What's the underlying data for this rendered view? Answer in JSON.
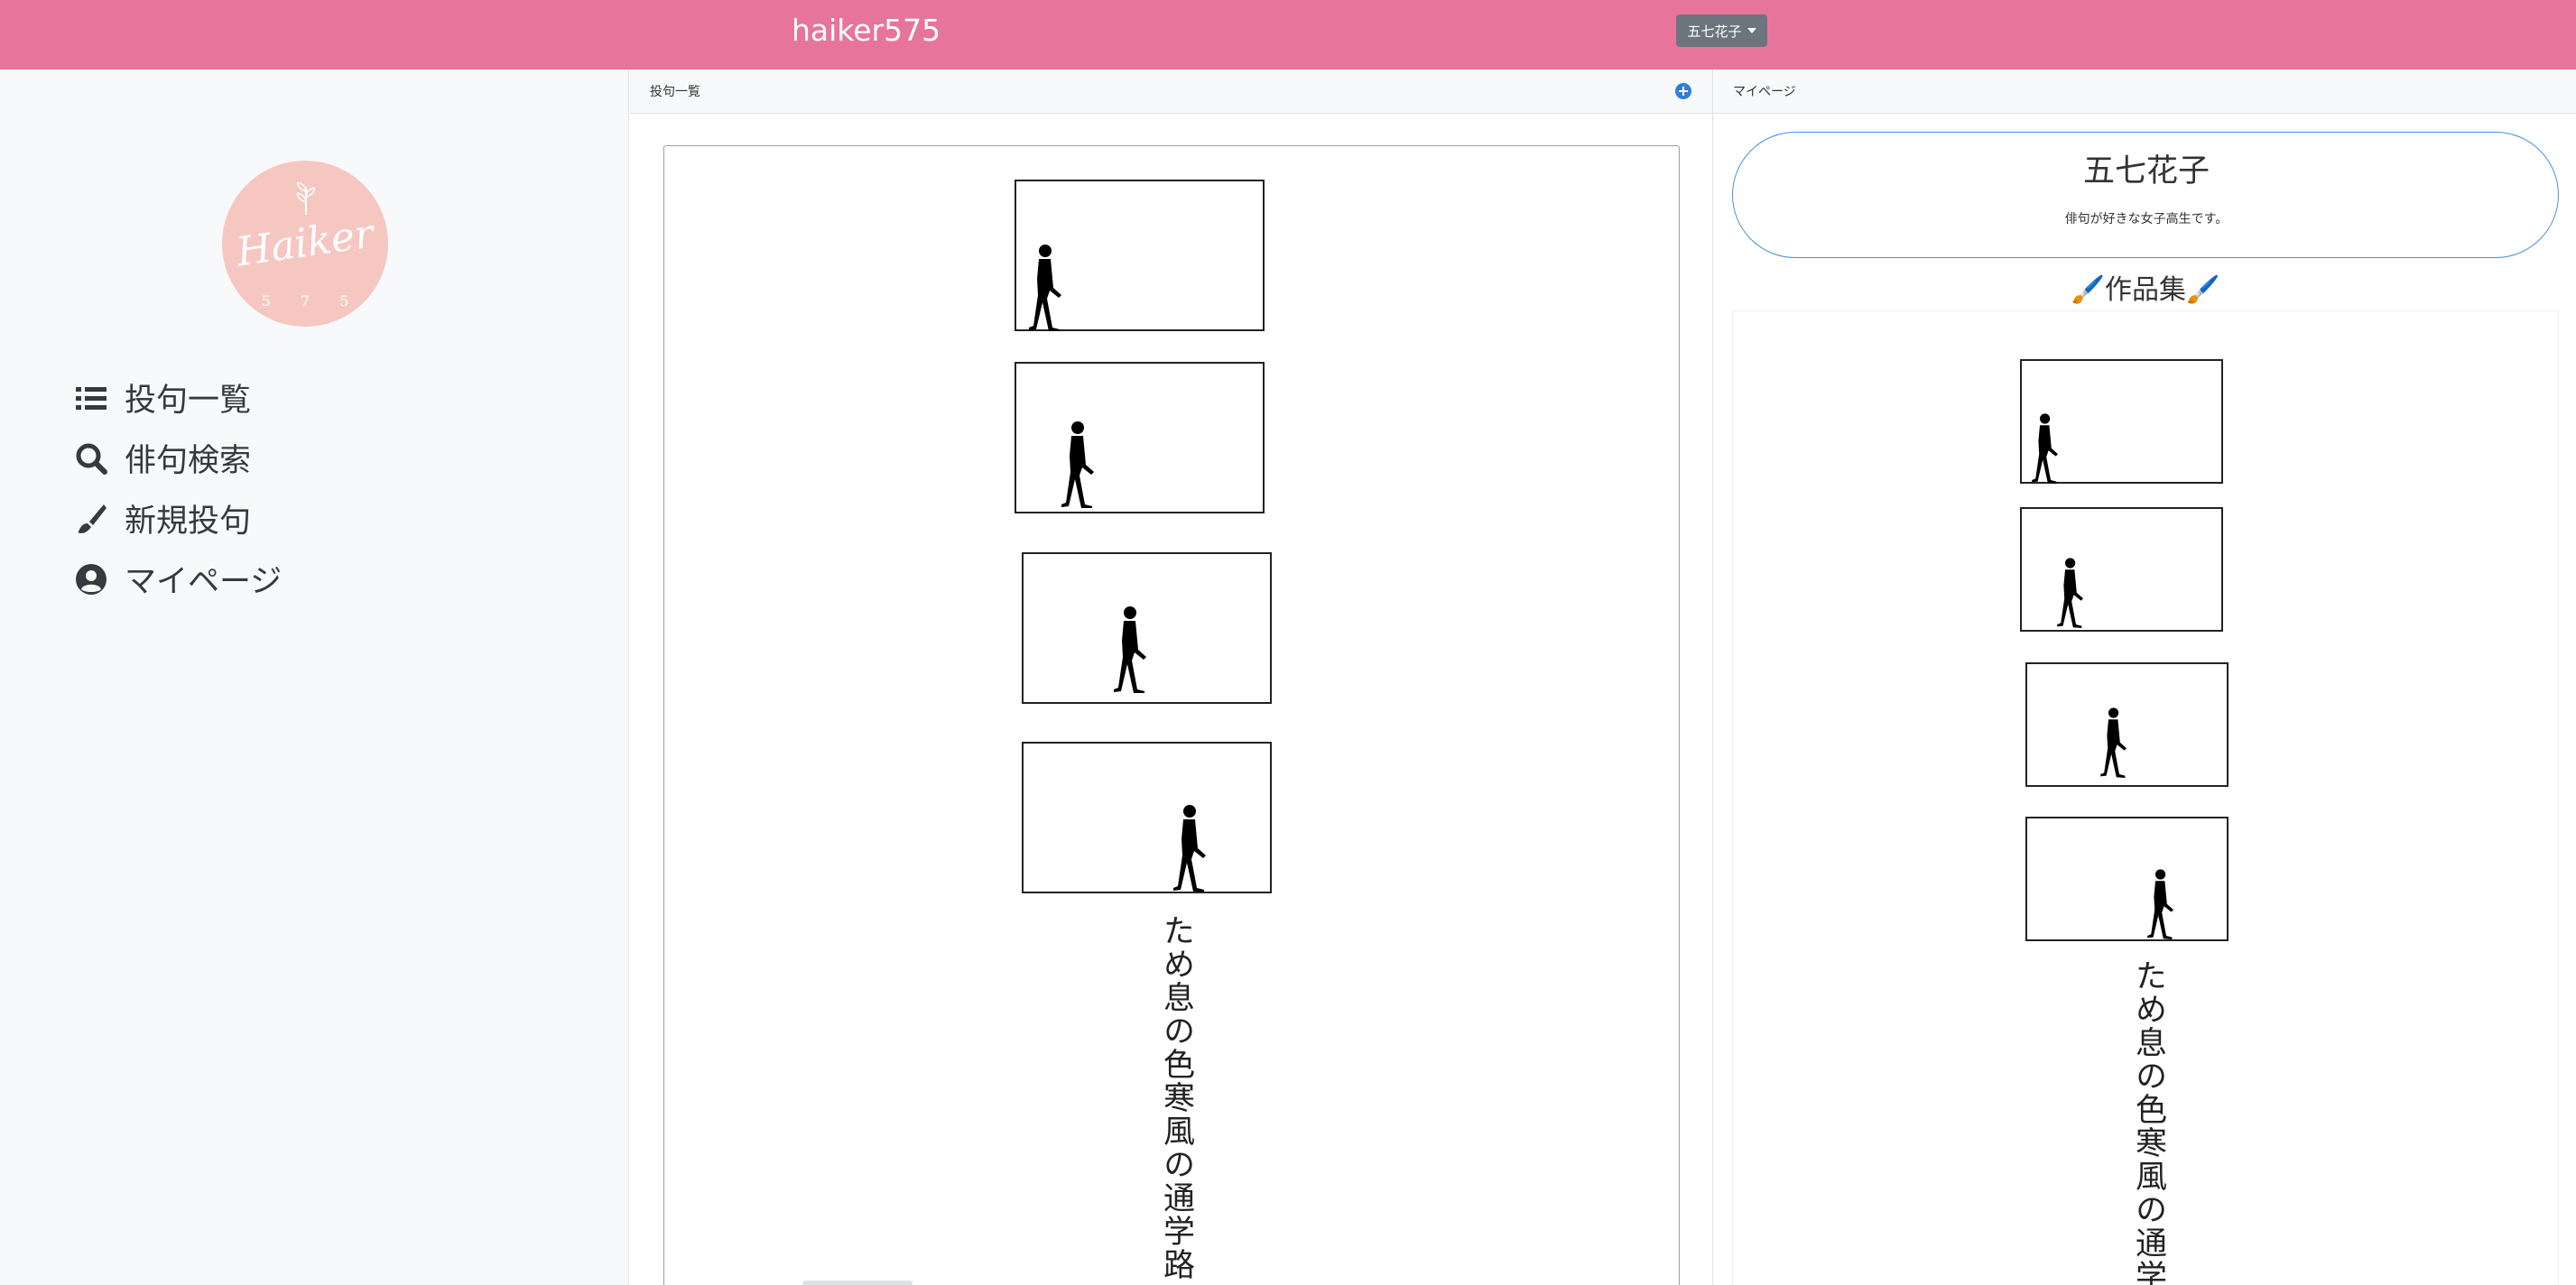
{
  "header": {
    "brand": "haiker575",
    "user_menu_label": "五七花子"
  },
  "sidebar": {
    "logo": {
      "text": "Haiker",
      "numbers": "5 7 5"
    },
    "items": [
      {
        "label": "投句一覧",
        "icon": "list-icon"
      },
      {
        "label": "俳句検索",
        "icon": "search-icon"
      },
      {
        "label": "新規投句",
        "icon": "brush-icon"
      },
      {
        "label": "マイページ",
        "icon": "user-circle-icon"
      }
    ]
  },
  "feed": {
    "title": "投句一覧",
    "haiku": "ため息の色寒風の通学路"
  },
  "mypage": {
    "title": "マイページ",
    "profile_name": "五七花子",
    "profile_bio": "俳句が好きな女子高生です。",
    "works_title": "🖌️作品集🖌️",
    "haiku": "ため息の色寒風の通学"
  },
  "colors": {
    "header": "#e7759b",
    "button": "#6c757d",
    "accent": "#2f7fd8"
  }
}
